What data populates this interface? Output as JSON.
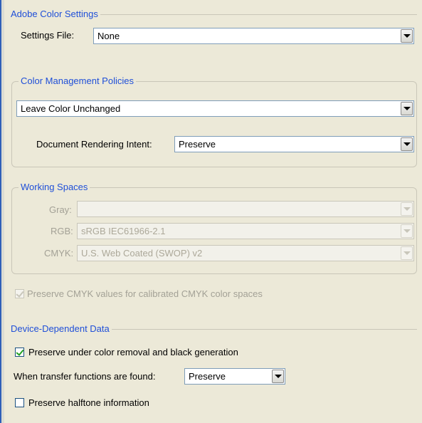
{
  "adobe_color_settings": {
    "title": "Adobe Color Settings",
    "settings_file_label": "Settings File:",
    "settings_file_value": "None"
  },
  "color_management_policies": {
    "title": "Color Management Policies",
    "policy_value": "Leave Color Unchanged",
    "rendering_intent_label": "Document Rendering Intent:",
    "rendering_intent_value": "Preserve"
  },
  "working_spaces": {
    "title": "Working Spaces",
    "gray_label": "Gray:",
    "gray_value": "",
    "rgb_label": "RGB:",
    "rgb_value": "sRGB IEC61966-2.1",
    "cmyk_label": "CMYK:",
    "cmyk_value": "U.S. Web Coated (SWOP) v2"
  },
  "preserve_cmyk": {
    "label": "Preserve CMYK values for calibrated CMYK color spaces",
    "checked": true,
    "enabled": false
  },
  "device_dependent_data": {
    "title": "Device-Dependent Data",
    "preserve_ucr_label": "Preserve under color removal and black generation",
    "preserve_ucr_checked": true,
    "transfer_label": "When transfer functions are found:",
    "transfer_value": "Preserve",
    "halftone_label": "Preserve halftone information",
    "halftone_checked": false
  }
}
